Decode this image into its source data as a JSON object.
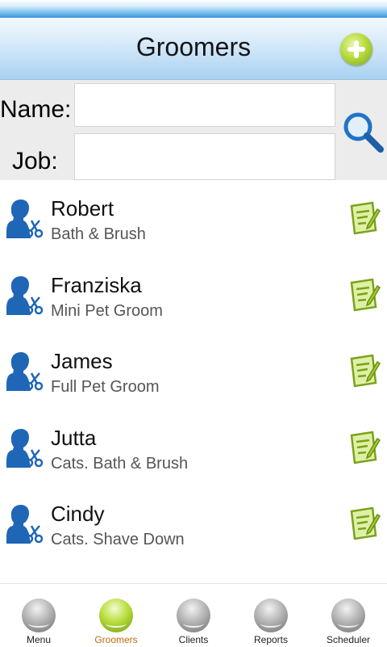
{
  "header": {
    "title": "Groomers"
  },
  "search": {
    "name_label": "Name:",
    "job_label": "Job:",
    "name_value": "",
    "job_value": ""
  },
  "groomers": [
    {
      "name": "Robert",
      "job": "Bath & Brush"
    },
    {
      "name": "Franziska",
      "job": "Mini Pet Groom"
    },
    {
      "name": "James",
      "job": "Full Pet Groom"
    },
    {
      "name": "Jutta",
      "job": "Cats. Bath & Brush"
    },
    {
      "name": "Cindy",
      "job": "Cats. Shave Down"
    }
  ],
  "tabs": [
    {
      "label": "Menu",
      "active": false
    },
    {
      "label": "Groomers",
      "active": true
    },
    {
      "label": "Clients",
      "active": false
    },
    {
      "label": "Reports",
      "active": false
    },
    {
      "label": "Scheduler",
      "active": false
    }
  ],
  "colors": {
    "accent_green": "#a3cc2b",
    "active_tab_text": "#c46a0a",
    "icon_blue": "#1f66b6",
    "header_blue": "#a9d2f1"
  },
  "icons": {
    "add": "add-circle-icon",
    "search": "magnifier-icon",
    "avatar": "groomer-person-scissors-icon",
    "edit": "edit-notepad-icon",
    "tab": "sphere-icon"
  }
}
